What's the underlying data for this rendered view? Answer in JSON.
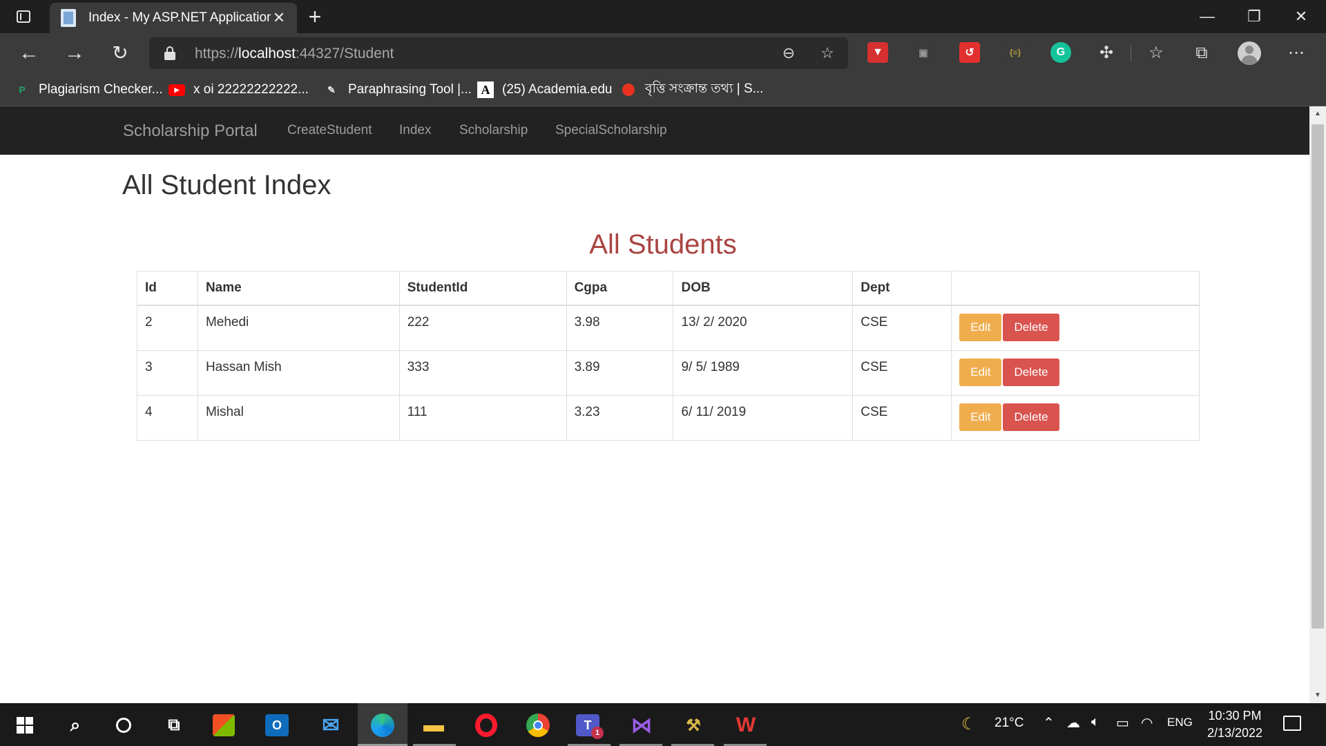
{
  "browser": {
    "tab": {
      "title": "Index - My ASP.NET Application",
      "close": "✕"
    },
    "new_tab": "+",
    "window_controls": {
      "minimize": "—",
      "restore": "❐",
      "close": "✕"
    },
    "url": {
      "scheme": "https://",
      "host": "localhost",
      "rest": ":44327/Student"
    },
    "bookmarks": [
      {
        "label": "Plagiarism Checker...",
        "icon": "plagiarism-checker-icon",
        "color": "#21a366"
      },
      {
        "label": "x oi 22222222222...",
        "icon": "youtube-icon",
        "color": "#ff0000"
      },
      {
        "label": "Paraphrasing Tool |...",
        "icon": "quill-icon",
        "color": "#e0e0e0"
      },
      {
        "label": "(25) Academia.edu",
        "icon": "academia-icon",
        "color": "#ffffff"
      },
      {
        "label": "বৃত্তি সংক্রান্ত তথ্য | S...",
        "icon": "red-dot-icon",
        "color": "#e8321f"
      }
    ]
  },
  "site": {
    "brand": "Scholarship Portal",
    "nav": [
      "CreateStudent",
      "Index",
      "Scholarship",
      "SpecialScholarship"
    ],
    "page_title": "All Student Index",
    "table_title": "All Students",
    "columns": [
      "Id",
      "Name",
      "StudentId",
      "Cgpa",
      "DOB",
      "Dept",
      ""
    ],
    "rows": [
      {
        "id": "2",
        "name": "Mehedi",
        "student_id": "222",
        "cgpa": "3.98",
        "dob": "13/ 2/ 2020",
        "dept": "CSE"
      },
      {
        "id": "3",
        "name": "Hassan Mish",
        "student_id": "333",
        "cgpa": "3.89",
        "dob": "9/ 5/ 1989",
        "dept": "CSE"
      },
      {
        "id": "4",
        "name": "Mishal",
        "student_id": "111",
        "cgpa": "3.23",
        "dob": "6/ 11/ 2019",
        "dept": "CSE"
      }
    ],
    "actions": {
      "edit": "Edit",
      "delete": "Delete"
    },
    "colors": {
      "edit": "#f0ad4e",
      "delete": "#d9534f",
      "title": "#a94442",
      "navbar": "#222222"
    }
  },
  "taskbar": {
    "weather": "21°C",
    "language": "ENG",
    "time": "10:30 PM",
    "date": "2/13/2022",
    "teams_badge": "1"
  }
}
